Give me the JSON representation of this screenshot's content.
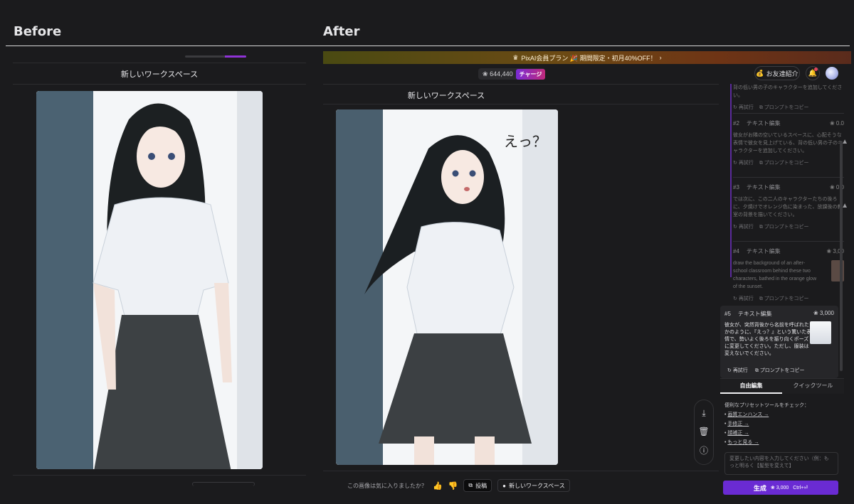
{
  "labels": {
    "before": "Before",
    "after": "After"
  },
  "before": {
    "progress": 0.35,
    "workspace_title": "新しいワークスペース"
  },
  "after": {
    "promo": {
      "crown": "♛",
      "text": "PixAI会員プラン 🎉 期間限定・初月40%OFF！",
      "arrow": "›"
    },
    "credits": {
      "icon": "❀",
      "amount": "644,440",
      "charge": "チャージ"
    },
    "invite": {
      "icon": "💰",
      "label": "お友達紹介"
    },
    "bell_icon": "🔔",
    "workspace_title": "新しいワークスペース",
    "tools": [
      "⤓",
      "🗑",
      "ⓘ"
    ],
    "feedback": {
      "question": "この画像は気に入りましたか？",
      "like_icon": "👍",
      "dislike_icon": "👎",
      "post_label": "投稿",
      "workspace_label": "新しいワークスペース"
    }
  },
  "history": [
    {
      "text": "背の低い男の子のキャラクターを追加してください。",
      "retry": "再試行",
      "copy": "プロンプトをコピー"
    },
    {
      "num": "#2",
      "title": "テキスト編集",
      "cost": "❀ 0.0",
      "text": "彼女がお隣の空いているスペースに、心配そうな表情で彼女を見上げている、背の低い男の子のキャラクターを追加してください。",
      "retry": "再試行",
      "copy": "プロンプトをコピー"
    },
    {
      "num": "#3",
      "title": "テキスト編集",
      "cost": "❀ 0.0",
      "text": "では次に、この二人のキャラクターたちの後ろに、夕焼けでオレンジ色に染まった、放課後の教室の背景を描いてください。",
      "retry": "再試行",
      "copy": "プロンプトをコピー"
    },
    {
      "num": "#4",
      "title": "テキスト編集",
      "cost": "❀ 3,00",
      "text": "draw the background of an after-school classroom behind these two characters, bathed in the orange glow of the sunset.",
      "retry": "再試行",
      "copy": "プロンプトをコピー"
    }
  ],
  "active": {
    "num": "#5",
    "title": "テキスト編集",
    "cost": "❀ 3,000",
    "text": "彼女が、突然背後から名前を呼ばれたかのように、『えっ？』という驚いた表情で、勢いよく後ろを振り向くポーズに変更してください。ただし、服装は変えないでください。",
    "retry": "再試行",
    "copy": "プロンプトをコピー"
  },
  "tabs": [
    "自由編集",
    "クイックツール"
  ],
  "tips": {
    "intro": "便利なプリセットツールをチェック：",
    "links": [
      "画質エンハンス →",
      "手修正 →",
      "顔補正 →",
      "もっと見る →"
    ]
  },
  "prompt_placeholder": "変更したい内容を入力してください（例：もっと明るく【髪型を変えて】",
  "generate": {
    "label": "生成",
    "cost": "❀ 3,000",
    "shortcut": "Ctrl+⏎"
  },
  "image_text": "えっ？"
}
